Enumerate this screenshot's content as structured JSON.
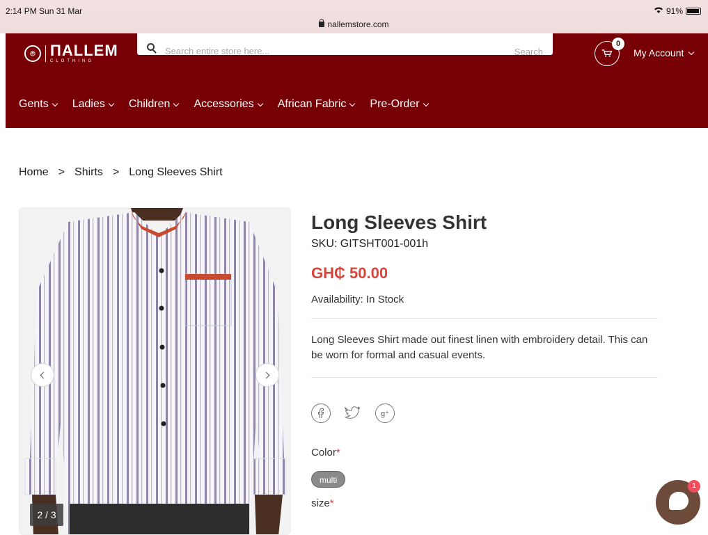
{
  "status_bar": {
    "time": "2:14 PM  Sun 31 Mar",
    "battery": "91%",
    "url": "nallemstore.com"
  },
  "header": {
    "logo": {
      "brand": "ΠALLEM",
      "sub": "CLOTHING"
    },
    "search": {
      "placeholder": "Search entire store here...",
      "button_label": "Search"
    },
    "cart_count": "0",
    "account_label": "My Account",
    "brand_color": "#760006"
  },
  "nav": {
    "items": [
      {
        "label": "Gents"
      },
      {
        "label": "Ladies"
      },
      {
        "label": "Children"
      },
      {
        "label": "Accessories"
      },
      {
        "label": "African Fabric"
      },
      {
        "label": "Pre-Order"
      }
    ]
  },
  "breadcrumb": {
    "items": [
      "Home",
      ">",
      "Shirts",
      ">",
      "Long Sleeves Shirt"
    ]
  },
  "gallery": {
    "counter": "2 / 3"
  },
  "product": {
    "title": "Long Sleeves Shirt",
    "sku": "SKU: GITSHT001-001h",
    "price": "GH₵ 50.00",
    "availability": "Availability: In Stock",
    "description": "Long Sleeves Shirt made out finest linen with embroidery detail. This can be worn for formal and casual events.",
    "color_label": "Color",
    "color_option": "multi",
    "size_label": "size",
    "required_mark": "*",
    "price_color": "#d9443a"
  },
  "chat": {
    "badge": "1"
  }
}
